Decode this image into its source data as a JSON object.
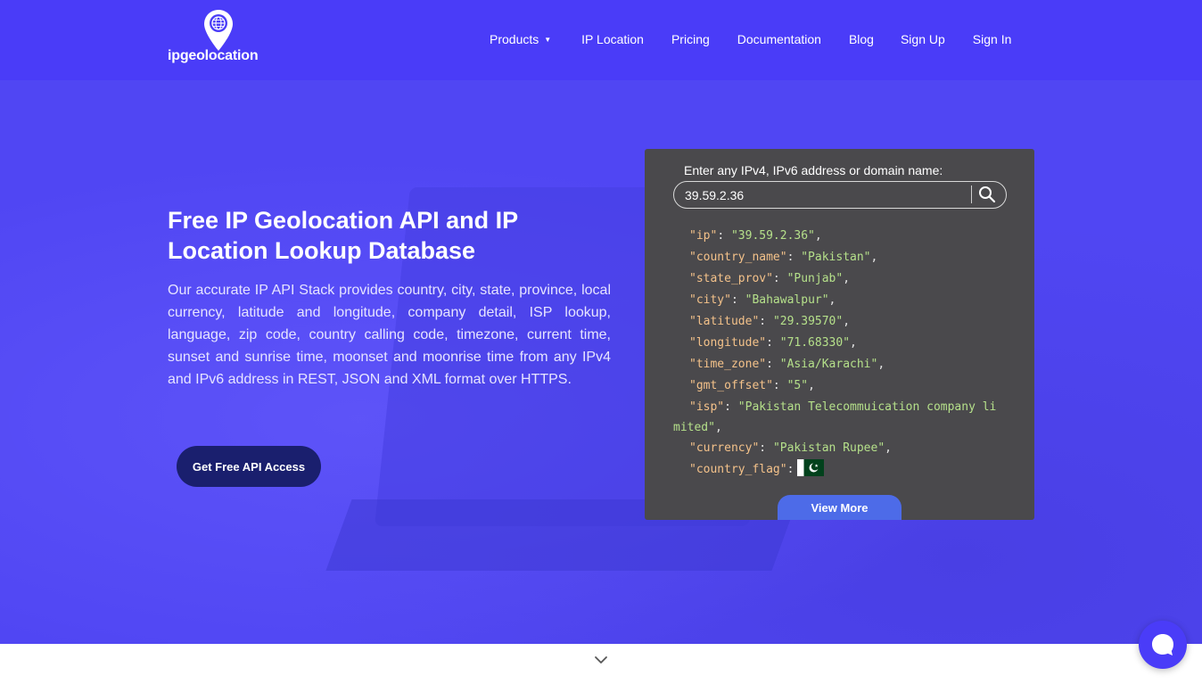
{
  "brand": {
    "name": "ipgeolocation"
  },
  "nav": {
    "items": [
      {
        "label": "Products",
        "has_dropdown": true
      },
      {
        "label": "IP Location"
      },
      {
        "label": "Pricing"
      },
      {
        "label": "Documentation"
      },
      {
        "label": "Blog"
      },
      {
        "label": "Sign Up"
      },
      {
        "label": "Sign In"
      }
    ]
  },
  "hero": {
    "title": "Free IP Geolocation API and IP Location Lookup Database",
    "description": "Our accurate IP API Stack provides country, city, state, province, local currency, latitude and longitude, company detail, ISP lookup, language, zip code, country calling code, timezone, current time, sunset and sunrise time, moonset and moonrise time from any IPv4 and IPv6 address in REST, JSON and XML format over HTTPS.",
    "cta_label": "Get Free API Access"
  },
  "lookup": {
    "label": "Enter any IPv4, IPv6 address or domain name:",
    "input_value": "39.59.2.36",
    "view_more_label": "View More",
    "result": [
      {
        "key": "\"ip\"",
        "value": "\"39.59.2.36\""
      },
      {
        "key": "\"country_name\"",
        "value": "\"Pakistan\""
      },
      {
        "key": "\"state_prov\"",
        "value": "\"Punjab\""
      },
      {
        "key": "\"city\"",
        "value": "\"Bahawalpur\""
      },
      {
        "key": "\"latitude\"",
        "value": "\"29.39570\""
      },
      {
        "key": "\"longitude\"",
        "value": "\"71.68330\""
      },
      {
        "key": "\"time_zone\"",
        "value": "\"Asia/Karachi\""
      },
      {
        "key": "\"gmt_offset\"",
        "value": "\"5\""
      },
      {
        "key": "\"isp\"",
        "value_line1": "\"Pakistan Telecommuication company li",
        "value_line2": "mited\""
      },
      {
        "key": "\"currency\"",
        "value": "\"Pakistan Rupee\""
      },
      {
        "key": "\"country_flag\""
      }
    ]
  },
  "colors": {
    "navbar": "#4a3cf8",
    "hero": "#5046f3",
    "card": "#4a494c",
    "cta": "#1a1f6e",
    "view_more": "#4d6be8",
    "json_key": "#f4c28a",
    "json_string": "#b5e08a"
  },
  "icons": {
    "logo": "location-pin-globe-icon",
    "search": "search-icon",
    "dropdown": "caret-down-icon",
    "scroll": "chevron-down-icon",
    "chat": "chat-icon",
    "flag": "pakistan-flag-icon"
  }
}
